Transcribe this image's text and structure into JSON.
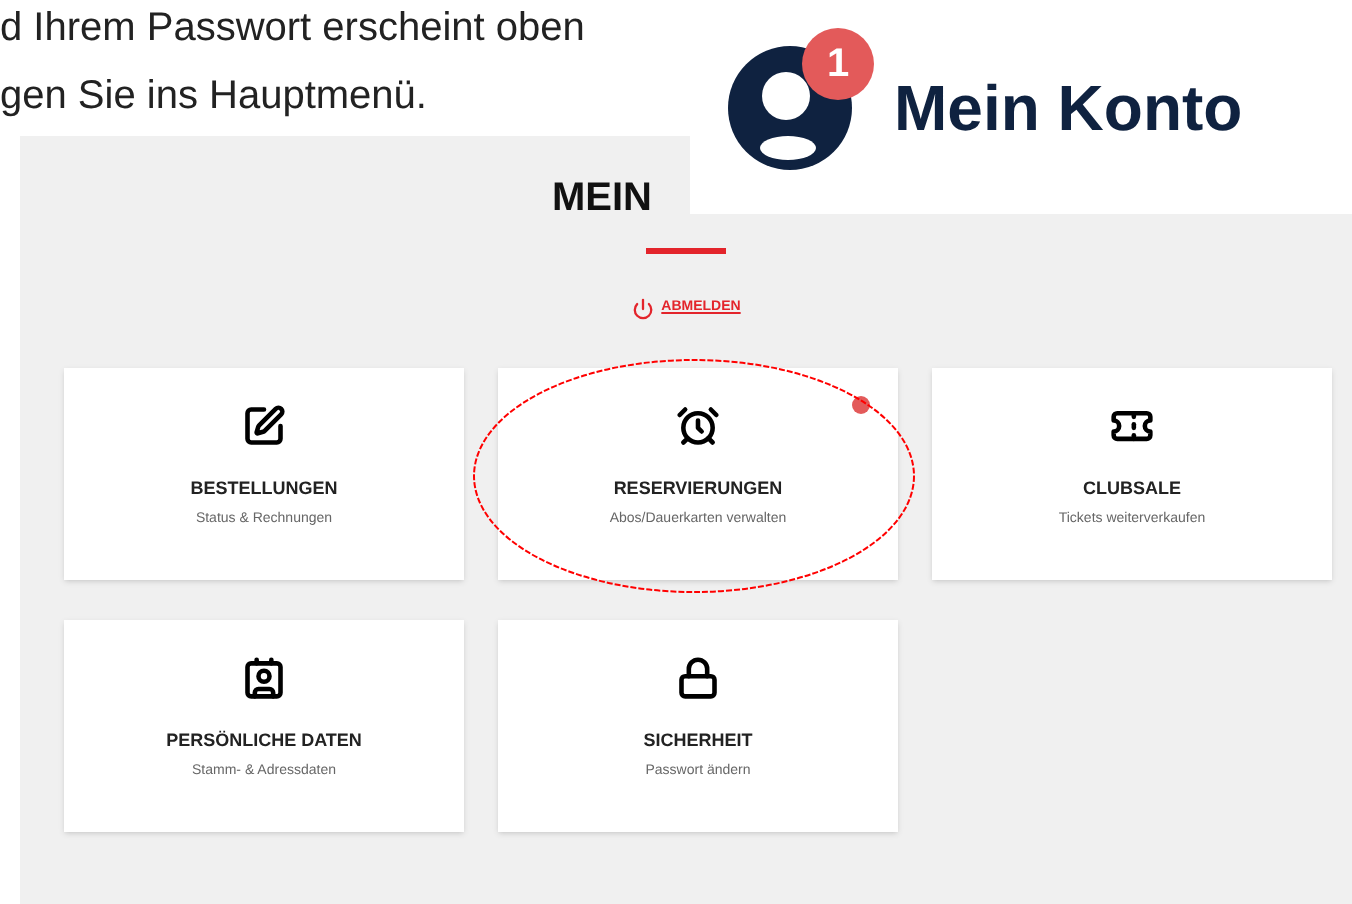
{
  "intro_lines": [
    "d Ihrem Passwort erscheint oben",
    "gen Sie ins Hauptmenü."
  ],
  "account_popup": {
    "title": "Mein Konto",
    "badge": "1"
  },
  "page": {
    "title": "MEIN",
    "logout_link": "ABMELDEN",
    "cards": [
      {
        "kind": "pen",
        "title": "BESTELLUNGEN",
        "subtitle": "Status & Rechnungen",
        "badge": false,
        "circled": false
      },
      {
        "kind": "alarm",
        "title": "RESERVIERUNGEN",
        "subtitle": "Abos/Dauerkarten verwalten",
        "badge": true,
        "circled": true
      },
      {
        "kind": "ticket",
        "title": "CLUBSALE",
        "subtitle": "Tickets weiterverkaufen",
        "badge": false,
        "circled": false
      },
      {
        "kind": "idcard",
        "title": "PERSÖNLICHE DATEN",
        "subtitle": "Stamm- & Adressdaten",
        "badge": false,
        "circled": false
      },
      {
        "kind": "lock",
        "title": "SICHERHEIT",
        "subtitle": "Passwort ändern",
        "badge": false,
        "circled": false
      }
    ]
  }
}
